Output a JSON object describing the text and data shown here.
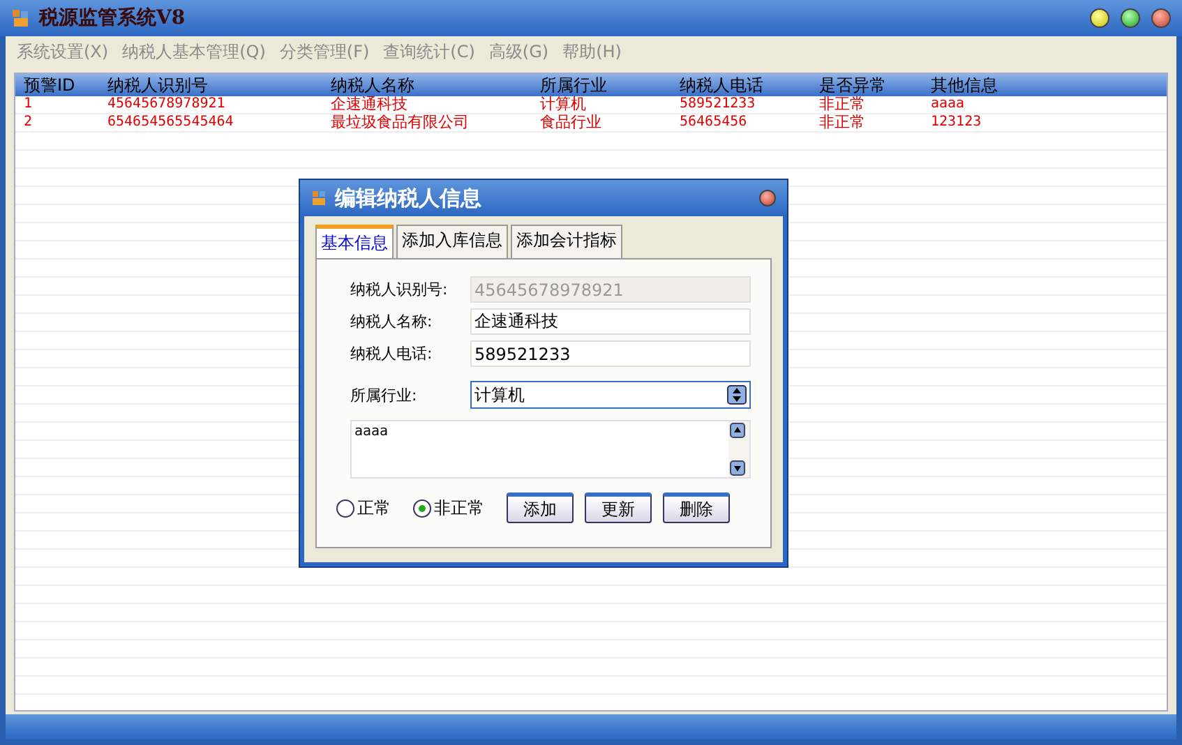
{
  "window": {
    "title": "税源监管系统V8"
  },
  "menu": [
    {
      "label": "系统设置(X)"
    },
    {
      "label": "纳税人基本管理(Q)"
    },
    {
      "label": "分类管理(F)"
    },
    {
      "label": "查询统计(C)"
    },
    {
      "label": "高级(G)"
    },
    {
      "label": "帮助(H)"
    }
  ],
  "table": {
    "columns": [
      "预警ID",
      "纳税人识别号",
      "纳税人名称",
      "所属行业",
      "纳税人电话",
      "是否异常",
      "其他信息"
    ],
    "rows": [
      {
        "cells": [
          "1",
          "45645678978921",
          "企速通科技",
          "计算机",
          "589521233",
          "非正常",
          "aaaa"
        ]
      },
      {
        "cells": [
          "2",
          "654654565545464",
          "最垃圾食品有限公司",
          "食品行业",
          "56465456",
          "非正常",
          "123123"
        ]
      }
    ]
  },
  "dialog": {
    "title": "编辑纳税人信息",
    "tabs": [
      {
        "label": "基本信息",
        "selected": true
      },
      {
        "label": "添加入库信息",
        "selected": false
      },
      {
        "label": "添加会计指标",
        "selected": false
      }
    ],
    "fields": [
      {
        "label": "纳税人识别号:",
        "value": "45645678978921",
        "disabled": true
      },
      {
        "label": "纳税人名称:",
        "value": "企速通科技",
        "disabled": false
      },
      {
        "label": "纳税人电话:",
        "value": "589521233",
        "disabled": false
      }
    ],
    "industry": {
      "label": "所属行业:",
      "value": "计算机"
    },
    "notes": "aaaa",
    "radios": [
      {
        "label": "正常",
        "selected": false
      },
      {
        "label": "非正常",
        "selected": true
      }
    ],
    "buttons": [
      "添加",
      "更新",
      "删除"
    ]
  }
}
